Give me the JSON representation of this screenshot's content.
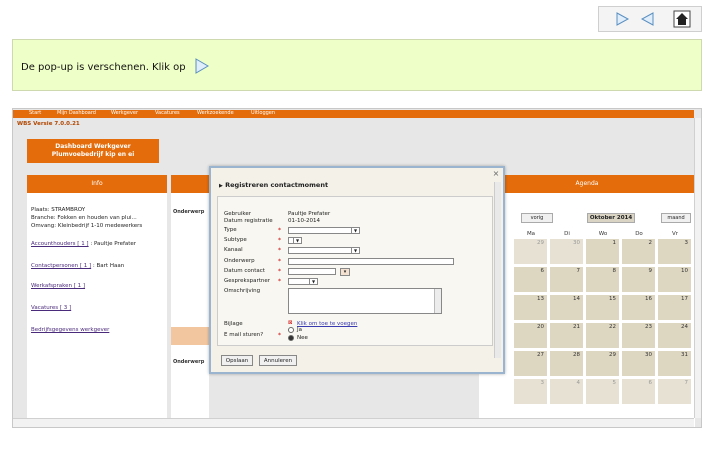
{
  "nav": {
    "forward": "forward-arrow",
    "back": "back-arrow",
    "home": "home"
  },
  "instruction": {
    "text": "De pop-up is verschenen. Klik op"
  },
  "app": {
    "menu": [
      "Start",
      "Mijn Dashboard",
      "Werkgever",
      "Vacatures",
      "Werkzoekende",
      "Uitloggen"
    ],
    "version": "WBS Versie 7.0.0.21",
    "dashboard_line1": "Dashboard Werkgever",
    "dashboard_line2": "Plumvoebedrijf kip en ei",
    "info": {
      "title": "Info",
      "plaats": "Plaats: STRAMBROY",
      "branche": "Branche: Fokken en houden van plui...",
      "omvang": "Omvang: Kleinbedrijf 1-10 medewerkers",
      "accounthouders_label": "Accounthouders [ 1 ]",
      "accounthouders_value": ": Paultje Prefater",
      "contactpersonen_label": "Contactpersonen [ 1 ]",
      "contactpersonen_value": ": Bart Haan",
      "werkafspraken": "Werkafspraken [ 1 ]",
      "vacatures": "Vacatures [ 3 ]",
      "bewerken": "Bedrijfsgegevens werkgever"
    },
    "mid": {
      "label1": "Onderwerp",
      "label2": "Onderwerp"
    },
    "agenda": {
      "title": "Agenda",
      "prev": "vorig",
      "month": "Oktober 2014",
      "next": "maand",
      "days": [
        "Ma",
        "Di",
        "Wo",
        "Do",
        "Vr"
      ],
      "weeks": [
        [
          {
            "d": "29",
            "o": true
          },
          {
            "d": "30",
            "o": true
          },
          {
            "d": "1",
            "o": false
          },
          {
            "d": "2",
            "o": false
          },
          {
            "d": "3",
            "o": false
          }
        ],
        [
          {
            "d": "6",
            "o": false
          },
          {
            "d": "7",
            "o": false
          },
          {
            "d": "8",
            "o": false
          },
          {
            "d": "9",
            "o": false
          },
          {
            "d": "10",
            "o": false
          }
        ],
        [
          {
            "d": "13",
            "o": false
          },
          {
            "d": "14",
            "o": false
          },
          {
            "d": "15",
            "o": false
          },
          {
            "d": "16",
            "o": false
          },
          {
            "d": "17",
            "o": false
          }
        ],
        [
          {
            "d": "20",
            "o": false
          },
          {
            "d": "21",
            "o": false
          },
          {
            "d": "22",
            "o": false
          },
          {
            "d": "23",
            "o": false
          },
          {
            "d": "24",
            "o": false
          }
        ],
        [
          {
            "d": "27",
            "o": false
          },
          {
            "d": "28",
            "o": false
          },
          {
            "d": "29",
            "o": false
          },
          {
            "d": "30",
            "o": false
          },
          {
            "d": "31",
            "o": false
          }
        ],
        [
          {
            "d": "3",
            "o": true
          },
          {
            "d": "4",
            "o": true
          },
          {
            "d": "5",
            "o": true
          },
          {
            "d": "6",
            "o": true
          },
          {
            "d": "7",
            "o": true
          }
        ]
      ]
    }
  },
  "modal": {
    "title": "Registreren contactmoment",
    "close": "×",
    "gebruiker_label": "Gebruiker",
    "gebruiker_value": "Paultje Prefater",
    "datum_registratie_label": "Datum registratie",
    "datum_registratie_value": "01-10-2014",
    "type_label": "Type",
    "subtype_label": "Subtype",
    "kanaal_label": "Kanaal",
    "onderwerp_label": "Onderwerp",
    "datum_contact_label": "Datum contact",
    "gesprekspartner_label": "Gesprekspartner",
    "omschrijving_label": "Omschrijving",
    "bijlage_label": "Bijlage",
    "bijlage_link": "Klik om toe te voegen",
    "email_label": "E mail sturen?",
    "radio_ja": "Ja",
    "radio_nee": "Nee",
    "required": "*",
    "opslaan": "Opslaan",
    "annuleren": "Annuleren"
  }
}
